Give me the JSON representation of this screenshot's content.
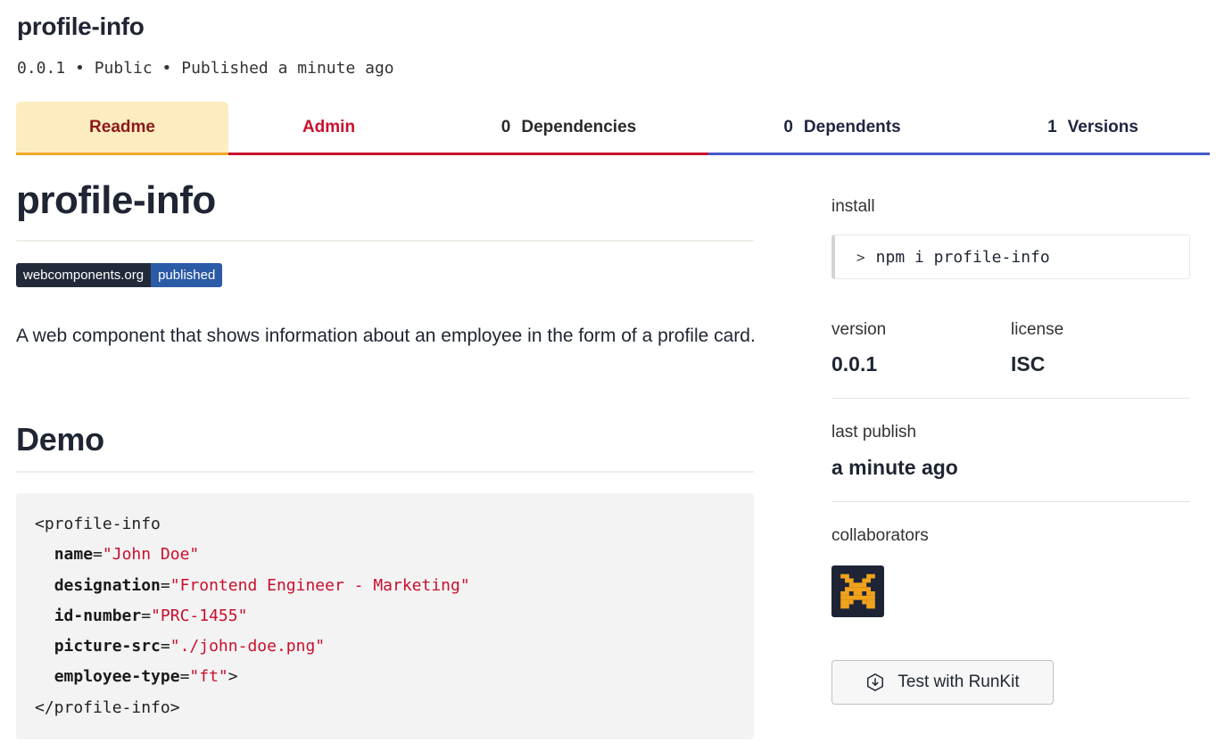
{
  "package": {
    "name": "profile-info",
    "meta": "0.0.1 • Public • Published a minute ago"
  },
  "tabs": {
    "readme": "Readme",
    "admin": "Admin",
    "dependencies": {
      "count": "0",
      "label": "Dependencies"
    },
    "dependents": {
      "count": "0",
      "label": "Dependents"
    },
    "versions": {
      "count": "1",
      "label": "Versions"
    }
  },
  "readme": {
    "title": "profile-info",
    "badge_left": "webcomponents.org",
    "badge_right": "published",
    "description": "A web component that shows information about an employee in the form of a profile card.",
    "demo_heading": "Demo",
    "code": {
      "open_tag": "<profile-info",
      "attrs": [
        {
          "name": "name",
          "value": "\"John Doe\"",
          "suffix": ""
        },
        {
          "name": "designation",
          "value": "\"Frontend Engineer - Marketing\"",
          "suffix": ""
        },
        {
          "name": "id-number",
          "value": "\"PRC-1455\"",
          "suffix": ""
        },
        {
          "name": "picture-src",
          "value": "\"./john-doe.png\"",
          "suffix": ""
        },
        {
          "name": "employee-type",
          "value": "\"ft\"",
          "suffix": ">"
        }
      ],
      "close_tag": "</profile-info>"
    }
  },
  "sidebar": {
    "install_label": "install",
    "install_prompt": ">",
    "install_command": "npm i profile-info",
    "version_label": "version",
    "version_value": "0.0.1",
    "license_label": "license",
    "license_value": "ISC",
    "last_publish_label": "last publish",
    "last_publish_value": "a minute ago",
    "collaborators_label": "collaborators",
    "runkit_label": "Test with RunKit"
  },
  "colors": {
    "readme_tab_bg": "#fdecc0",
    "admin_accent": "#c8102e",
    "dependents_accent": "#4758c8",
    "string_color": "#c8102e"
  },
  "icons": {
    "avatar": "pixel-invader-avatar",
    "runkit": "download-hex-icon"
  }
}
